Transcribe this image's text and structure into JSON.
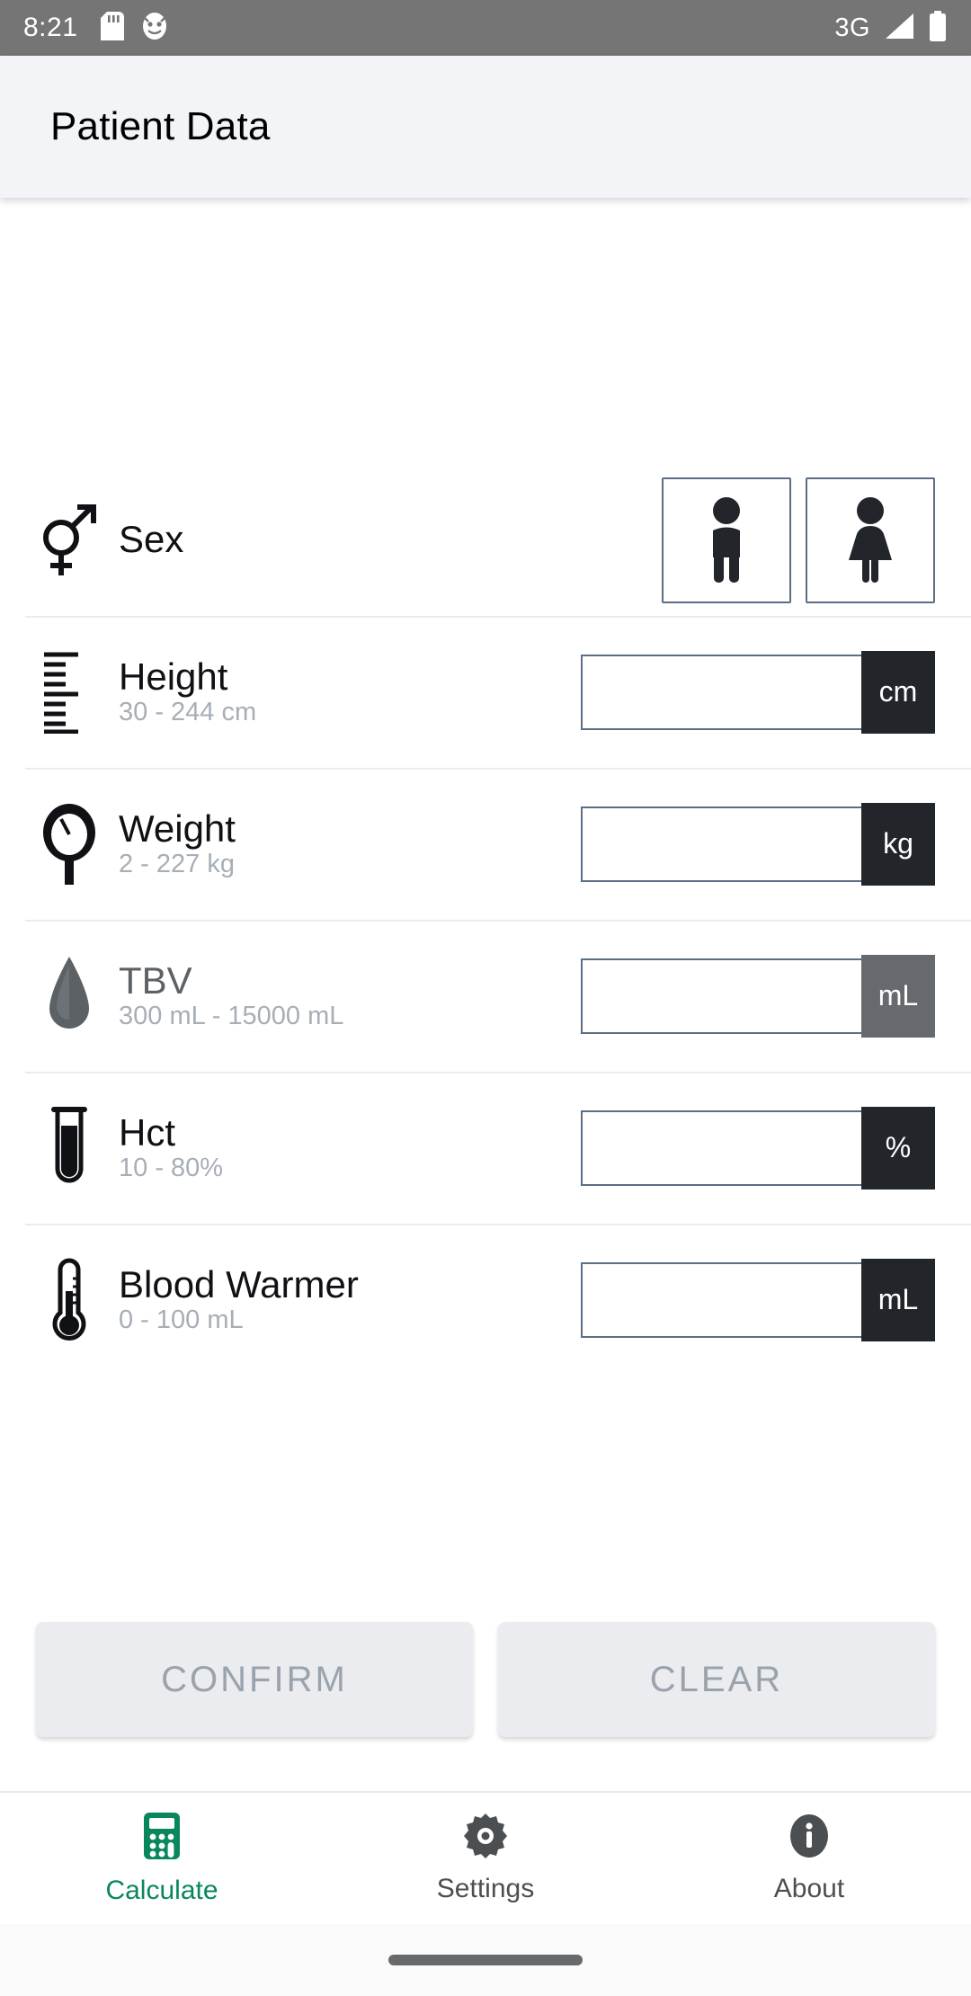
{
  "status_bar": {
    "clock": "8:21",
    "icons_left": [
      "sd-card-icon",
      "app-notification-icon"
    ],
    "network_label": "3G",
    "icons_right": [
      "signal-icon",
      "battery-icon"
    ]
  },
  "app_bar": {
    "title": "Patient Data"
  },
  "form": {
    "rows": [
      {
        "key": "sex",
        "icon": "male-female-symbol-icon",
        "label": "Sex",
        "range": "",
        "type": "choice",
        "options": [
          {
            "key": "male",
            "icon": "male-person-icon",
            "selected": false
          },
          {
            "key": "female",
            "icon": "female-person-icon",
            "selected": false
          }
        ]
      },
      {
        "key": "height",
        "icon": "ruler-icon",
        "label": "Height",
        "range": "30 - 244 cm",
        "type": "number",
        "value": "",
        "placeholder": "",
        "unit": "cm",
        "disabled": false
      },
      {
        "key": "weight",
        "icon": "scale-icon",
        "label": "Weight",
        "range": "2 - 227 kg",
        "type": "number",
        "value": "",
        "placeholder": "",
        "unit": "kg",
        "disabled": false
      },
      {
        "key": "tbv",
        "icon": "blood-drop-icon",
        "label": "TBV",
        "range": "300 mL - 15000 mL",
        "type": "number",
        "value": "",
        "placeholder": "",
        "unit": "mL",
        "disabled": true
      },
      {
        "key": "hct",
        "icon": "test-tube-icon",
        "label": "Hct",
        "range": "10 - 80%",
        "type": "number",
        "value": "",
        "placeholder": "",
        "unit": "%",
        "disabled": false
      },
      {
        "key": "blood_warmer",
        "icon": "thermometer-icon",
        "label": "Blood Warmer",
        "range": "0 - 100 mL",
        "type": "number",
        "value": "",
        "placeholder": "",
        "unit": "mL",
        "disabled": false
      }
    ]
  },
  "actions": {
    "confirm_label": "CONFIRM",
    "clear_label": "CLEAR"
  },
  "bottom_nav": {
    "items": [
      {
        "key": "calculate",
        "icon": "calculator-icon",
        "label": "Calculate",
        "active": true
      },
      {
        "key": "settings",
        "icon": "gear-icon",
        "label": "Settings",
        "active": false
      },
      {
        "key": "about",
        "icon": "info-icon",
        "label": "About",
        "active": false
      }
    ]
  },
  "colors": {
    "accent_green": "#09875c",
    "field_border": "#5b6e84",
    "unit_dark": "#22262b",
    "unit_disabled": "#66696d",
    "appbar_bg": "#f2f4f8",
    "statusbar_bg": "#757575",
    "muted_text": "#a7aeb6"
  }
}
